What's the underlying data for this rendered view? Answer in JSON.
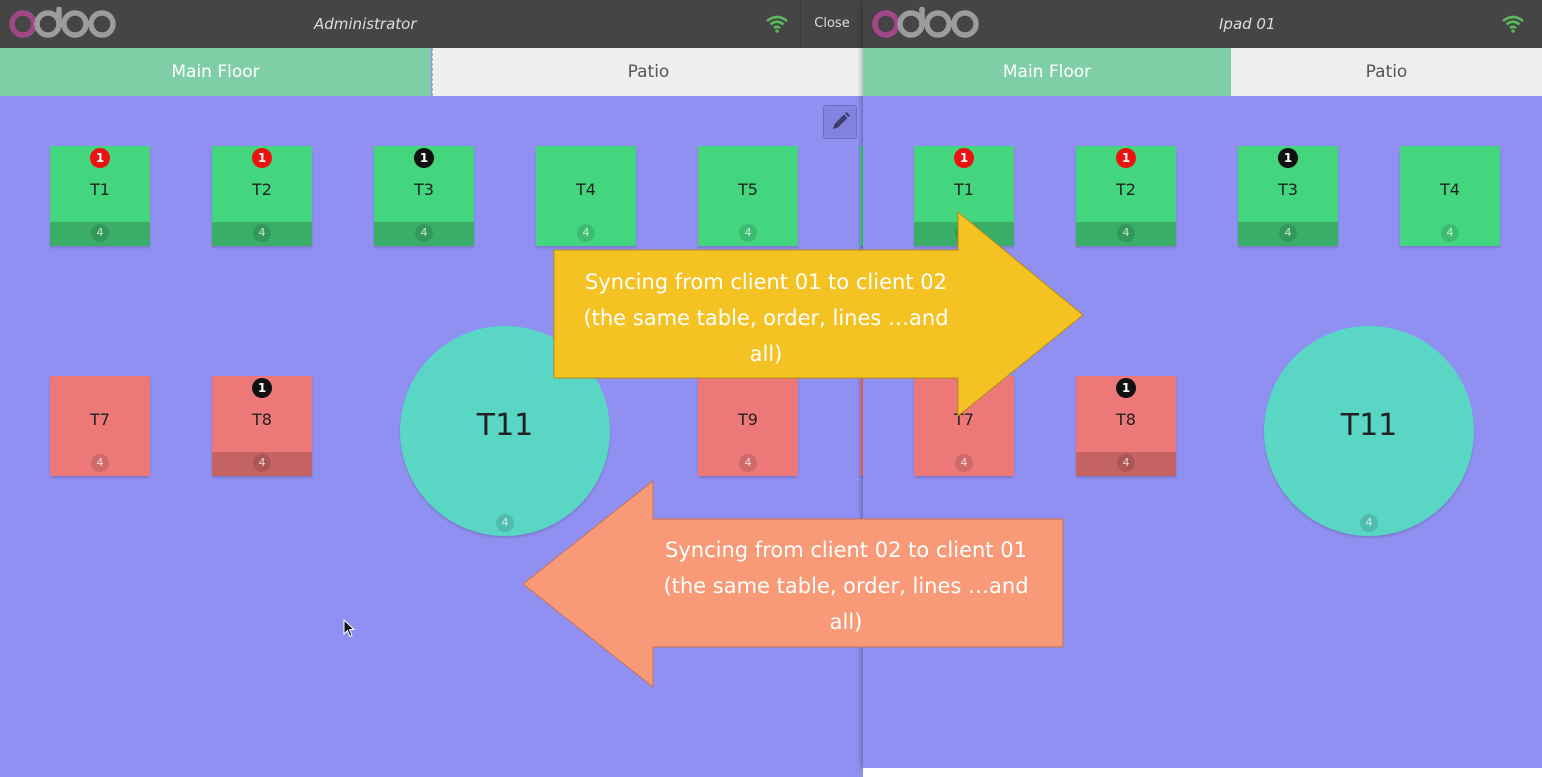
{
  "left_client": {
    "logo_text": "odoo",
    "user": "Administrator",
    "close_label": "Close",
    "tabs": [
      {
        "label": "Main Floor",
        "active": true
      },
      {
        "label": "Patio",
        "active": false
      }
    ],
    "tables": [
      {
        "name": "T1",
        "seats": "4",
        "badge": "1",
        "badge_color": "#ee1111",
        "status": "green",
        "occupied": true
      },
      {
        "name": "T2",
        "seats": "4",
        "badge": "1",
        "badge_color": "#ee1111",
        "status": "green",
        "occupied": true
      },
      {
        "name": "T3",
        "seats": "4",
        "badge": "1",
        "badge_color": "#111111",
        "status": "green",
        "occupied": true
      },
      {
        "name": "T4",
        "seats": "4",
        "badge": "",
        "status": "green",
        "occupied": false
      },
      {
        "name": "T5",
        "seats": "4",
        "badge": "",
        "status": "green",
        "occupied": false
      },
      {
        "name": "T7",
        "seats": "4",
        "badge": "",
        "status": "red",
        "occupied": false
      },
      {
        "name": "T8",
        "seats": "4",
        "badge": "1",
        "badge_color": "#111111",
        "status": "red",
        "occupied": true
      },
      {
        "name": "T11",
        "seats": "4",
        "badge": "",
        "status": "teal",
        "occupied": false,
        "shape": "round"
      },
      {
        "name": "T9",
        "seats": "4",
        "badge": "",
        "status": "red",
        "occupied": false
      }
    ]
  },
  "right_client": {
    "logo_text": "odoo",
    "user": "Ipad 01",
    "tabs": [
      {
        "label": "Main Floor",
        "active": true
      },
      {
        "label": "Patio",
        "active": false
      }
    ],
    "tables": [
      {
        "name": "T1",
        "seats": "4",
        "badge": "1",
        "badge_color": "#ee1111",
        "status": "green",
        "occupied": true
      },
      {
        "name": "T2",
        "seats": "4",
        "badge": "1",
        "badge_color": "#ee1111",
        "status": "green",
        "occupied": true
      },
      {
        "name": "T3",
        "seats": "4",
        "badge": "1",
        "badge_color": "#111111",
        "status": "green",
        "occupied": true
      },
      {
        "name": "T4",
        "seats": "4",
        "badge": "",
        "status": "green",
        "occupied": false
      },
      {
        "name": "T7",
        "seats": "4",
        "badge": "",
        "status": "red",
        "occupied": false
      },
      {
        "name": "T8",
        "seats": "4",
        "badge": "1",
        "badge_color": "#111111",
        "status": "red",
        "occupied": true
      },
      {
        "name": "T11",
        "seats": "4",
        "badge": "",
        "status": "teal",
        "occupied": false,
        "shape": "round"
      }
    ]
  },
  "callouts": {
    "to_client_02": {
      "lines": [
        "Syncing from client 01 to client 02",
        "(the same table, order, lines …and",
        "all)"
      ],
      "color": "#f5c224"
    },
    "to_client_01": {
      "lines": [
        "Syncing from client 02 to client 01",
        "(the same table, order, lines …and",
        "all)"
      ],
      "color": "#f89a77"
    }
  },
  "colors": {
    "floor": "#9090f2",
    "topbar": "#454545",
    "active_tab": "#7fcea6",
    "table_green": "#44d67f",
    "table_red": "#ed7878",
    "table_round": "#5ad6c5",
    "wifi": "#5cb85c"
  },
  "icons": {
    "edit": "pencil-icon",
    "connection": "wifi-icon",
    "cursor": "mouse-cursor-icon"
  }
}
